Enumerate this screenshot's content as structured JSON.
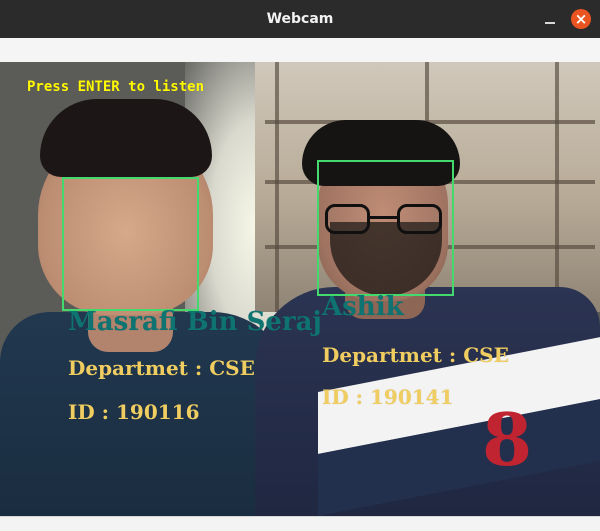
{
  "window": {
    "title": "Webcam",
    "minimize_icon": "minimize-icon",
    "close_icon": "close-icon",
    "close_symbol": "×"
  },
  "overlay": {
    "prompt": "Press ENTER to listen",
    "people": [
      {
        "name": "Masrafi Bin Seraj",
        "department": "Departmet : CSE",
        "id": "ID : 190116"
      },
      {
        "name": "Ashik",
        "department": "Departmet : CSE",
        "id": "ID : 190141"
      }
    ]
  },
  "colors": {
    "titlebar": "#2b2b2b",
    "close_button": "#e95420",
    "prompt_text": "#fffa00",
    "name_text": "#0e7371",
    "detail_text": "#f0cd61",
    "face_box": "#43d96c"
  },
  "icons": {
    "shirt_logo": "8"
  }
}
